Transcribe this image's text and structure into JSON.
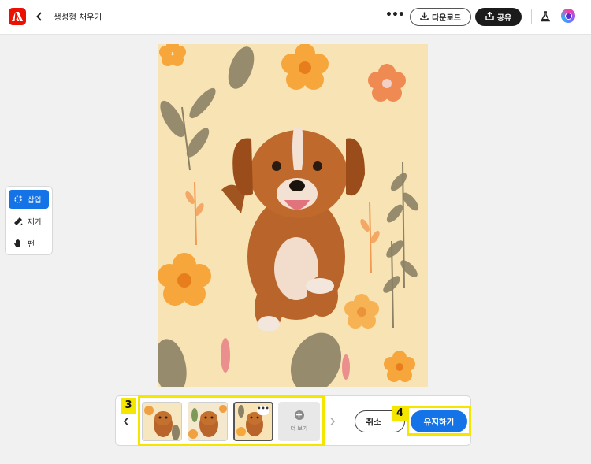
{
  "header": {
    "title": "생성형 채우기",
    "more_label": "•••",
    "download_label": "다운로드",
    "share_label": "공유"
  },
  "tools": [
    {
      "label": "삽입",
      "icon": "insert-sparkle-icon",
      "active": true
    },
    {
      "label": "제거",
      "icon": "eraser-icon",
      "active": false
    },
    {
      "label": "팬",
      "icon": "hand-pan-icon",
      "active": false
    }
  ],
  "canvas": {
    "subject": "puppy-on-floral-pattern",
    "colors": {
      "background": "#f8e3b4",
      "petal": "#f7a63c",
      "leaf": "#8b8266",
      "dog": "#b8642a"
    }
  },
  "variations": {
    "count": 3,
    "selected_index": 2,
    "more_card_label": "더 보기"
  },
  "actions": {
    "cancel_label": "취소",
    "keep_label": "유지하기"
  },
  "annotations": [
    {
      "number": "3",
      "target": "variations"
    },
    {
      "number": "4",
      "target": "keep-button"
    }
  ],
  "colors": {
    "accent": "#1473e6",
    "brand": "#eb1000",
    "annotation": "#f5e600"
  }
}
